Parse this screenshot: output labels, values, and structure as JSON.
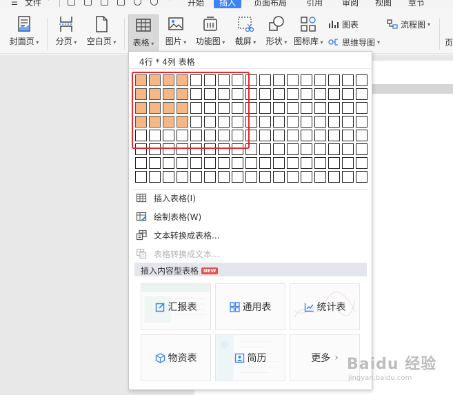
{
  "menubar": {
    "file_label": "文件",
    "items": [
      "开始",
      "插入",
      "页面布局",
      "引用",
      "审阅",
      "视图",
      "章节"
    ],
    "active": "插入"
  },
  "ribbon": {
    "buttons": {
      "cover": "封面页",
      "page_break": "分页",
      "blank_page": "空白页",
      "table": "表格",
      "picture": "图片",
      "function_chart": "功能图",
      "screenshot": "截屏",
      "shape": "形状",
      "icon_library": "图标库"
    },
    "small": {
      "chart": "图表",
      "mindmap": "思维导图",
      "flowchart": "流程图",
      "right_cut": "页"
    }
  },
  "dropdown": {
    "size_label": "4行 * 4列 表格",
    "grid": {
      "rows": 8,
      "cols": 17,
      "selected_rows": 4,
      "selected_cols": 4
    },
    "menu": {
      "insert_table": "插入表格(I)",
      "draw_table": "绘制表格(W)",
      "text_to_table": "文本转换成表格...",
      "table_to_text": "表格转换成文本..."
    },
    "section_title": "插入内容型表格",
    "new_badge": "NEW",
    "cards": {
      "report": "汇报表",
      "general": "通用表",
      "statistics": "统计表",
      "materials": "物资表",
      "resume": "简历",
      "more": "更多"
    }
  },
  "watermark": {
    "brand": "Baidu 经验",
    "url": "jingyan.baidu.com"
  },
  "colors": {
    "accent": "#3d83f2",
    "selected_cell": "#f7b784",
    "highlight": "#e8262d",
    "new_badge": "#e8504a"
  }
}
